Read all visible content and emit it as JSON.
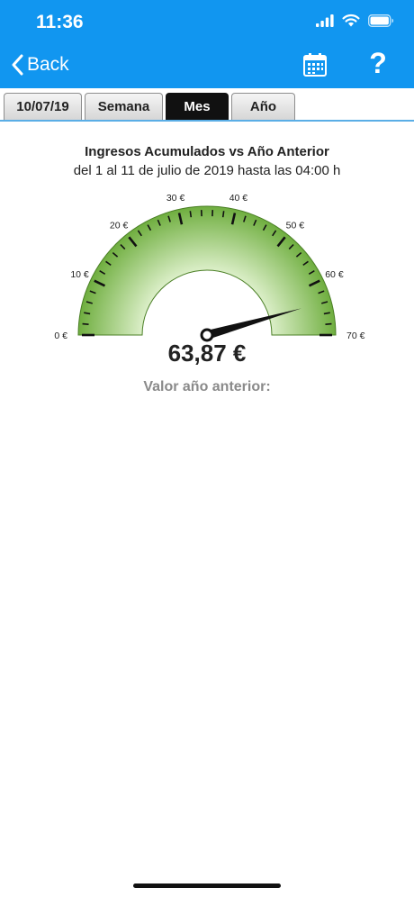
{
  "status_bar": {
    "time": "11:36",
    "icons": [
      "signal-icon",
      "wifi-icon",
      "battery-icon"
    ]
  },
  "nav": {
    "back_label": "Back",
    "calendar_icon": "calendar-icon",
    "help_label": "?"
  },
  "tabs": [
    {
      "label": "10/07/19",
      "active": false
    },
    {
      "label": "Semana",
      "active": false
    },
    {
      "label": "Mes",
      "active": true
    },
    {
      "label": "Año",
      "active": false
    }
  ],
  "colors": {
    "accent": "#1196f0",
    "gauge_fill_outer": "#6fae3f",
    "gauge_fill_inner": "#dcefc9",
    "needle": "#111111"
  },
  "chart_data": {
    "type": "gauge",
    "title": "Ingresos Acumulados vs Año Anterior",
    "subtitle": "del 1 al 11 de julio de 2019 hasta las 04:00 h",
    "min": 0,
    "max": 70,
    "major_ticks": [
      0,
      10,
      20,
      30,
      40,
      50,
      60,
      70
    ],
    "tick_labels": [
      "0 €",
      "10 €",
      "20 €",
      "30 €",
      "40 €",
      "50 €",
      "60 €",
      "70 €"
    ],
    "minor_tick_step": 2,
    "value": 63.87,
    "value_label": "63,87 €",
    "previous_label": "Valor año anterior:"
  }
}
